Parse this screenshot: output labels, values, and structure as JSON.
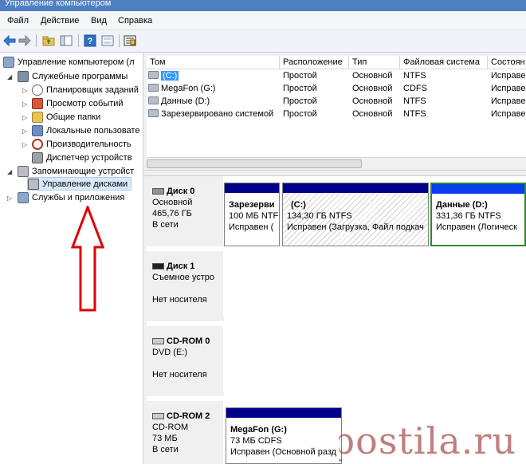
{
  "window": {
    "title": "Управление компьютером"
  },
  "menu": [
    "Файл",
    "Действие",
    "Вид",
    "Справка"
  ],
  "toolbar": {
    "icons": [
      "back-icon",
      "forward-icon",
      "up-folder-icon",
      "show-hide-tree-icon",
      "help-icon",
      "properties-icon",
      "export-icon"
    ]
  },
  "tree": {
    "root": "Управление компьютером (л",
    "groups": [
      {
        "label": "Служебные программы",
        "children": [
          "Планировщик заданий",
          "Просмотр событий",
          "Общие папки",
          "Локальные пользовате",
          "Производительность",
          "Диспетчер устройств"
        ]
      },
      {
        "label": "Запоминающие устройст",
        "children": [
          "Управление дисками"
        ]
      },
      {
        "label": "Службы и приложения",
        "children": []
      }
    ]
  },
  "volumes": {
    "columns": [
      "Том",
      "Расположение",
      "Тип",
      "Файловая система",
      "Состоян"
    ],
    "rows": [
      {
        "name": "(C:)",
        "layout": "Простой",
        "type": "Основной",
        "fs": "NTFS",
        "status": "Исправе",
        "selected": true
      },
      {
        "name": "MegaFon (G:)",
        "layout": "Простой",
        "type": "Основной",
        "fs": "CDFS",
        "status": "Исправе",
        "selected": false
      },
      {
        "name": "Данные (D:)",
        "layout": "Простой",
        "type": "Основной",
        "fs": "NTFS",
        "status": "Исправе",
        "selected": false
      },
      {
        "name": "Зарезервировано системой",
        "layout": "Простой",
        "type": "Основной",
        "fs": "NTFS",
        "status": "Исправе",
        "selected": false
      }
    ]
  },
  "disks": [
    {
      "name": "Диск 0",
      "kind": "Основной",
      "size": "465,76 ГБ",
      "status": "В сети",
      "partitions": [
        {
          "title": "Зарезерви",
          "detail": "100 МБ NTF",
          "state": "Исправен ("
        },
        {
          "title": "(C:)",
          "detail": "134,30 ГБ NTFS",
          "state": "Исправен (Загрузка, Файл подкач"
        },
        {
          "title": "Данные  (D:)",
          "detail": "331,36 ГБ NTFS",
          "state": "Исправен (Логическ"
        }
      ]
    },
    {
      "name": "Диск 1",
      "kind": "Съемное устро",
      "size": "",
      "status": "Нет носителя",
      "partitions": []
    },
    {
      "name": "CD-ROM 0",
      "kind": "DVD (E:)",
      "size": "",
      "status": "Нет носителя",
      "partitions": []
    },
    {
      "name": "CD-ROM 2",
      "kind": "CD-ROM",
      "size": "73 МБ",
      "status": "В сети",
      "partitions": [
        {
          "title": "MegaFon  (G:)",
          "detail": "73 МБ CDFS",
          "state": "Исправен (Основной разд"
        }
      ]
    }
  ],
  "watermark": "postila.ru",
  "colors": {
    "primary_partition_bar": "#00008b",
    "logical_partition_bar": "#0a3cf0",
    "selection": "#3399ff",
    "arrow": "#e00000"
  }
}
